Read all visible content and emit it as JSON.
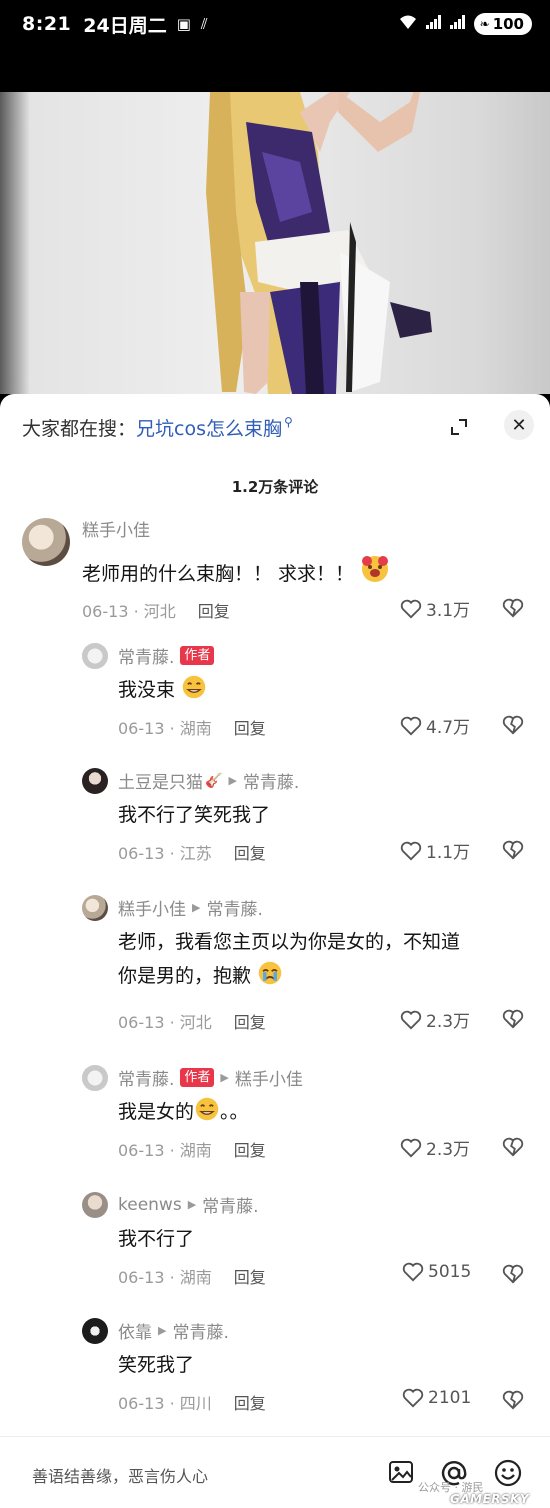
{
  "status_bar": {
    "time": "8:21",
    "date": "24日周二",
    "battery": "100"
  },
  "sheet": {
    "search_prefix": "大家都在搜：",
    "search_keyword": "兄坑cos怎么束胸",
    "comment_count": "1.2万条评论"
  },
  "comments": [
    {
      "user": "糕手小佳",
      "text": "老师用的什么束胸！！ 求求！！",
      "date": "06-13 · 河北",
      "reply_label": "回复",
      "likes": "3.1万"
    },
    {
      "user": "常青藤.",
      "author_tag": "作者",
      "text": "我没束",
      "date": "06-13 · 湖南",
      "reply_label": "回复",
      "likes": "4.7万"
    },
    {
      "user": "土豆是只猫",
      "reply_to": "常青藤.",
      "text": "我不行了笑死我了",
      "date": "06-13 · 江苏",
      "reply_label": "回复",
      "likes": "1.1万"
    },
    {
      "user": "糕手小佳",
      "reply_to": "常青藤.",
      "text_line1": "老师，我看您主页以为你是女的，不知道",
      "text_line2": "你是男的，抱歉",
      "date": "06-13 · 河北",
      "reply_label": "回复",
      "likes": "2.3万"
    },
    {
      "user": "常青藤.",
      "author_tag": "作者",
      "reply_to": "糕手小佳",
      "text": "我是女的",
      "text_suffix": "。。",
      "date": "06-13 · 湖南",
      "reply_label": "回复",
      "likes": "2.3万"
    },
    {
      "user": "keenws",
      "reply_to": "常青藤.",
      "text": "我不行了",
      "date": "06-13 · 湖南",
      "reply_label": "回复",
      "likes": "5015"
    },
    {
      "user": "依靠",
      "reply_to": "常青藤.",
      "text": "笑死我了",
      "date": "06-13 · 四川",
      "reply_label": "回复",
      "likes": "2101"
    }
  ],
  "input_bar": {
    "placeholder": "善语结善缘，恶言伤人心"
  },
  "watermark": {
    "text": "公众号 · 游民",
    "brand": "GAMERSKY"
  },
  "colors": {
    "author_tag": "#e8364b",
    "search_keyword": "#2f5db8"
  }
}
